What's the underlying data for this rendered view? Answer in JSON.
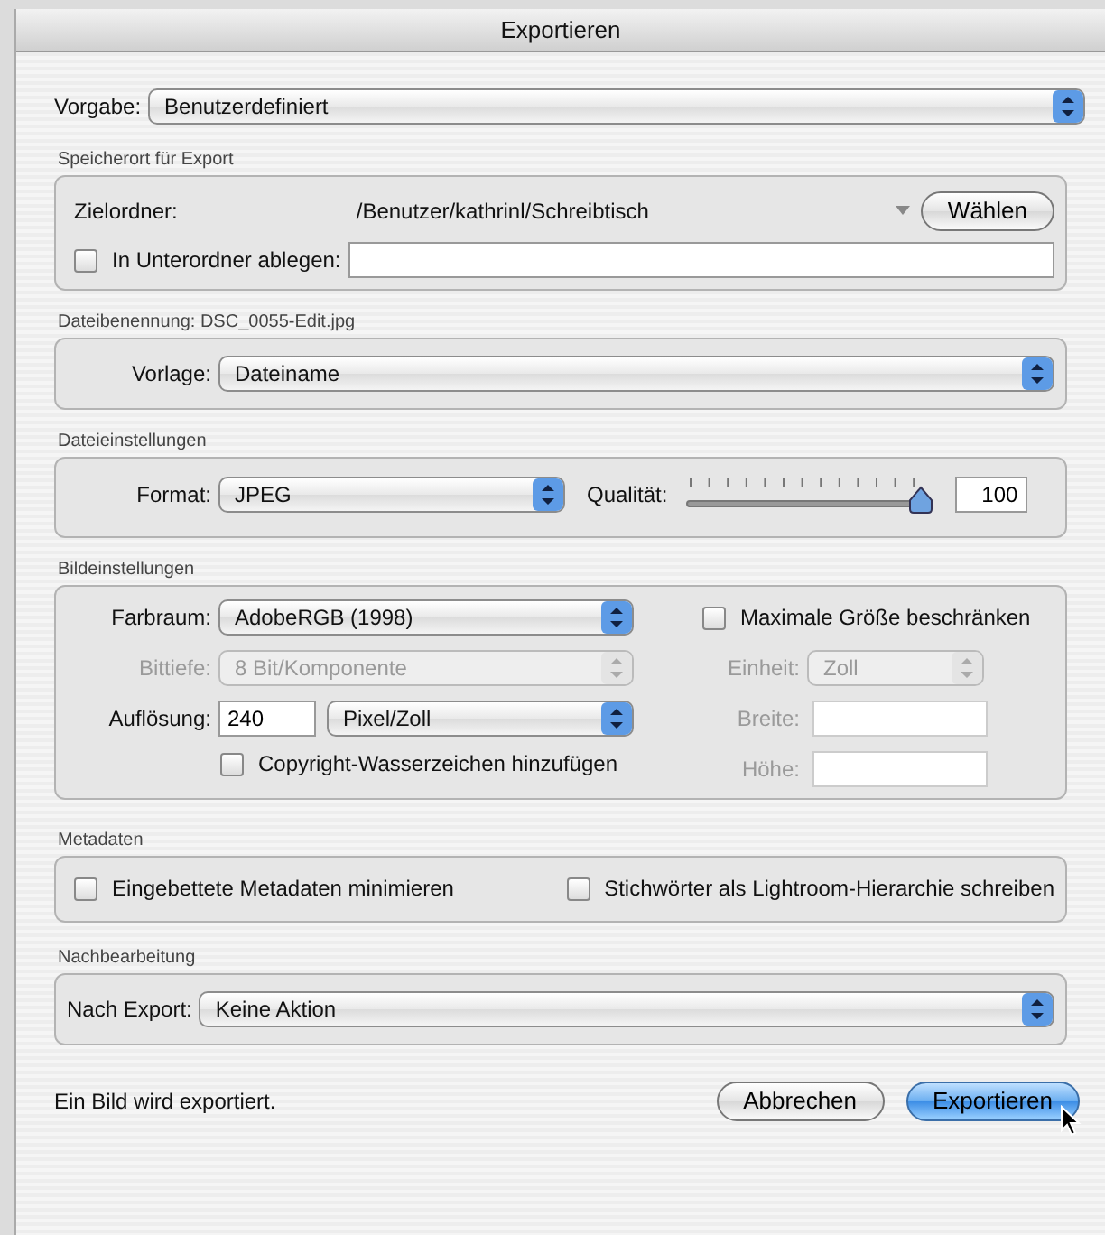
{
  "window": {
    "title": "Exportieren"
  },
  "preset": {
    "label": "Vorgabe:",
    "value": "Benutzerdefiniert"
  },
  "export_location": {
    "title": "Speicherort für Export",
    "folder_label": "Zielordner:",
    "folder_path": "/Benutzer/kathrinl/Schreibtisch",
    "choose_button": "Wählen",
    "subfolder": {
      "label": "In Unterordner ablegen:",
      "checked": false
    }
  },
  "file_naming": {
    "title": "Dateibenennung: DSC_0055-Edit.jpg",
    "template_label": "Vorlage:",
    "template": "Dateiname"
  },
  "file_settings": {
    "title": "Dateieinstellungen",
    "format_label": "Format:",
    "format": "JPEG",
    "quality_label": "Qualität:",
    "quality": {
      "level": 1.0
    },
    "quality_value": "100"
  },
  "image_settings": {
    "title": "Bildeinstellungen",
    "color_space_label": "Farbraum:",
    "color_space": "AdobeRGB (1998)",
    "bit_depth": {
      "label": "Bittiefe:",
      "value": "8 Bit/Komponente",
      "disabled": true
    },
    "resolution_label": "Auflösung:",
    "resolution": "240",
    "resolution_unit": "Pixel/Zoll",
    "watermark": {
      "label": "Copyright-Wasserzeichen hinzufügen",
      "checked": false
    },
    "limit_size": {
      "label": "Maximale Größe beschränken",
      "checked": false
    },
    "unit": {
      "label": "Einheit:",
      "value": "Zoll",
      "disabled": true
    },
    "width": {
      "label": "Breite:",
      "disabled": true
    },
    "height": {
      "label": "Höhe:",
      "disabled": true
    }
  },
  "metadata": {
    "title": "Metadaten",
    "options": [
      {
        "label": "Eingebettete Metadaten minimieren",
        "checked": false
      },
      {
        "label": "Stichwörter als Lightroom-Hierarchie schreiben",
        "checked": false
      }
    ]
  },
  "post_processing": {
    "title": "Nachbearbeitung",
    "label": "Nach Export:",
    "value": "Keine Aktion"
  },
  "footer": {
    "status": "Ein Bild wird exportiert.",
    "buttons": [
      {
        "label": "Abbrechen",
        "default": false
      },
      {
        "label": "Exportieren",
        "default": true
      }
    ]
  }
}
